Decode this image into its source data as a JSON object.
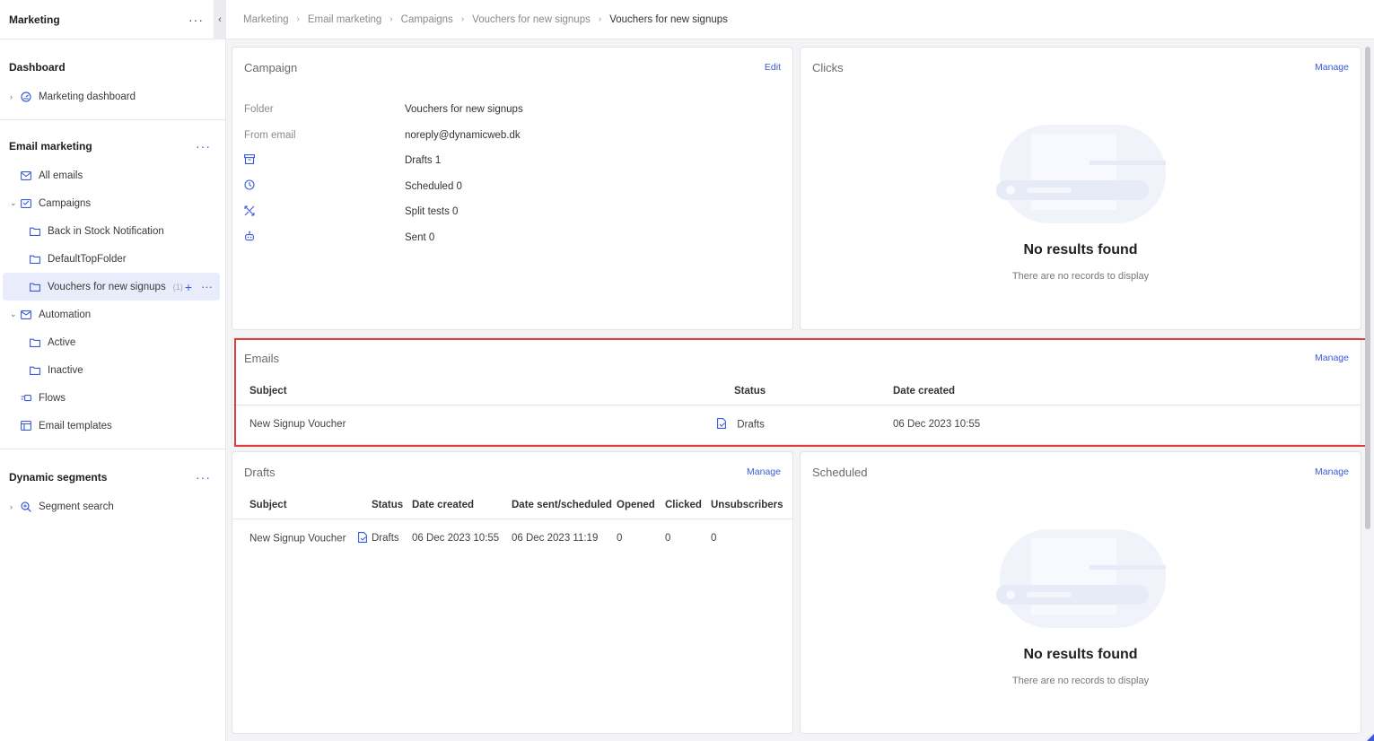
{
  "sidebar": {
    "title": "Marketing",
    "sections": {
      "dashboard": {
        "title": "Dashboard",
        "items": [
          {
            "label": "Marketing dashboard"
          }
        ]
      },
      "email": {
        "title": "Email marketing",
        "items": [
          {
            "label": "All emails"
          },
          {
            "label": "Campaigns"
          },
          {
            "label": "Back in Stock Notification"
          },
          {
            "label": "DefaultTopFolder"
          },
          {
            "label": "Vouchers for new signups",
            "count": "(1)"
          },
          {
            "label": "Automation"
          },
          {
            "label": "Active"
          },
          {
            "label": "Inactive"
          },
          {
            "label": "Flows"
          },
          {
            "label": "Email templates"
          }
        ]
      },
      "segments": {
        "title": "Dynamic segments",
        "items": [
          {
            "label": "Segment search"
          }
        ]
      }
    }
  },
  "breadcrumb": [
    "Marketing",
    "Email marketing",
    "Campaigns",
    "Vouchers for new signups",
    "Vouchers for new signups"
  ],
  "campaign": {
    "title": "Campaign",
    "edit": "Edit",
    "folder_label": "Folder",
    "folder_value": "Vouchers for new signups",
    "from_label": "From email",
    "from_value": "noreply@dynamicweb.dk",
    "drafts": "Drafts 1",
    "scheduled": "Scheduled 0",
    "split": "Split tests 0",
    "sent": "Sent 0"
  },
  "clicks": {
    "title": "Clicks",
    "manage": "Manage",
    "empty_title": "No results found",
    "empty_sub": "There are no records to display"
  },
  "emails": {
    "title": "Emails",
    "manage": "Manage",
    "columns": [
      "Subject",
      "Status",
      "Date created"
    ],
    "rows": [
      {
        "subject": "New Signup Voucher",
        "status": "Drafts",
        "date": "06 Dec 2023 10:55"
      }
    ]
  },
  "drafts": {
    "title": "Drafts",
    "manage": "Manage",
    "columns": [
      "Subject",
      "Status",
      "Date created",
      "Date sent/scheduled",
      "Opened",
      "Clicked",
      "Unsubscribers"
    ],
    "rows": [
      {
        "subject": "New Signup Voucher",
        "status": "Drafts",
        "created": "06 Dec 2023 10:55",
        "sent": "06 Dec 2023 11:19",
        "opened": "0",
        "clicked": "0",
        "unsub": "0"
      }
    ]
  },
  "scheduled": {
    "title": "Scheduled",
    "manage": "Manage",
    "empty_title": "No results found",
    "empty_sub": "There are no records to display"
  },
  "colors": {
    "accent": "#3a5bd9",
    "highlight": "#e0393e"
  }
}
